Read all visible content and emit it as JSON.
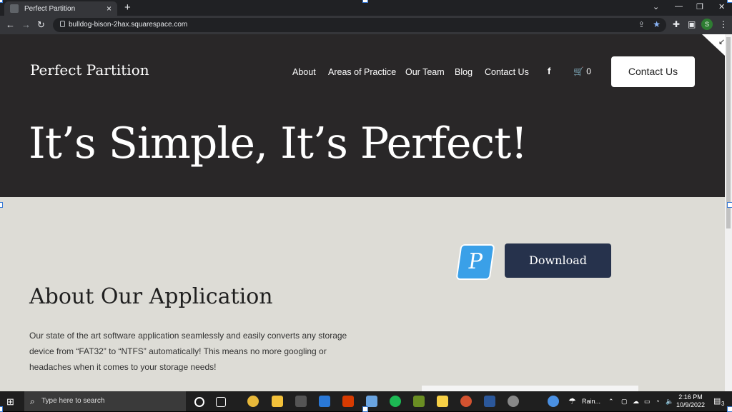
{
  "browser": {
    "tab_title": "Perfect Partition",
    "url": "bulldog-bison-2hax.squarespace.com",
    "profile_initial": "S"
  },
  "site": {
    "brand": "Perfect Partition",
    "nav": [
      "About",
      "Areas of Practice",
      "Our Team",
      "Blog",
      "Contact Us"
    ],
    "facebook": "f",
    "cart_count": "0",
    "contact_button": "Contact Us",
    "hero_title": "It’s Simple, It’s Perfect!",
    "logo_letter": "P",
    "download_button": "Download",
    "about_title": "About Our Application",
    "about_text": "Our state of the art software application seamlessly and easily converts any storage device from “FAT32” to “NTFS” automatically! This means no more googling or headaches when it comes to your storage needs!"
  },
  "taskbar": {
    "search_placeholder": "Type here to search",
    "weather": "Rain...",
    "time": "2:16 PM",
    "date": "10/9/2022",
    "notif_count": "3"
  }
}
